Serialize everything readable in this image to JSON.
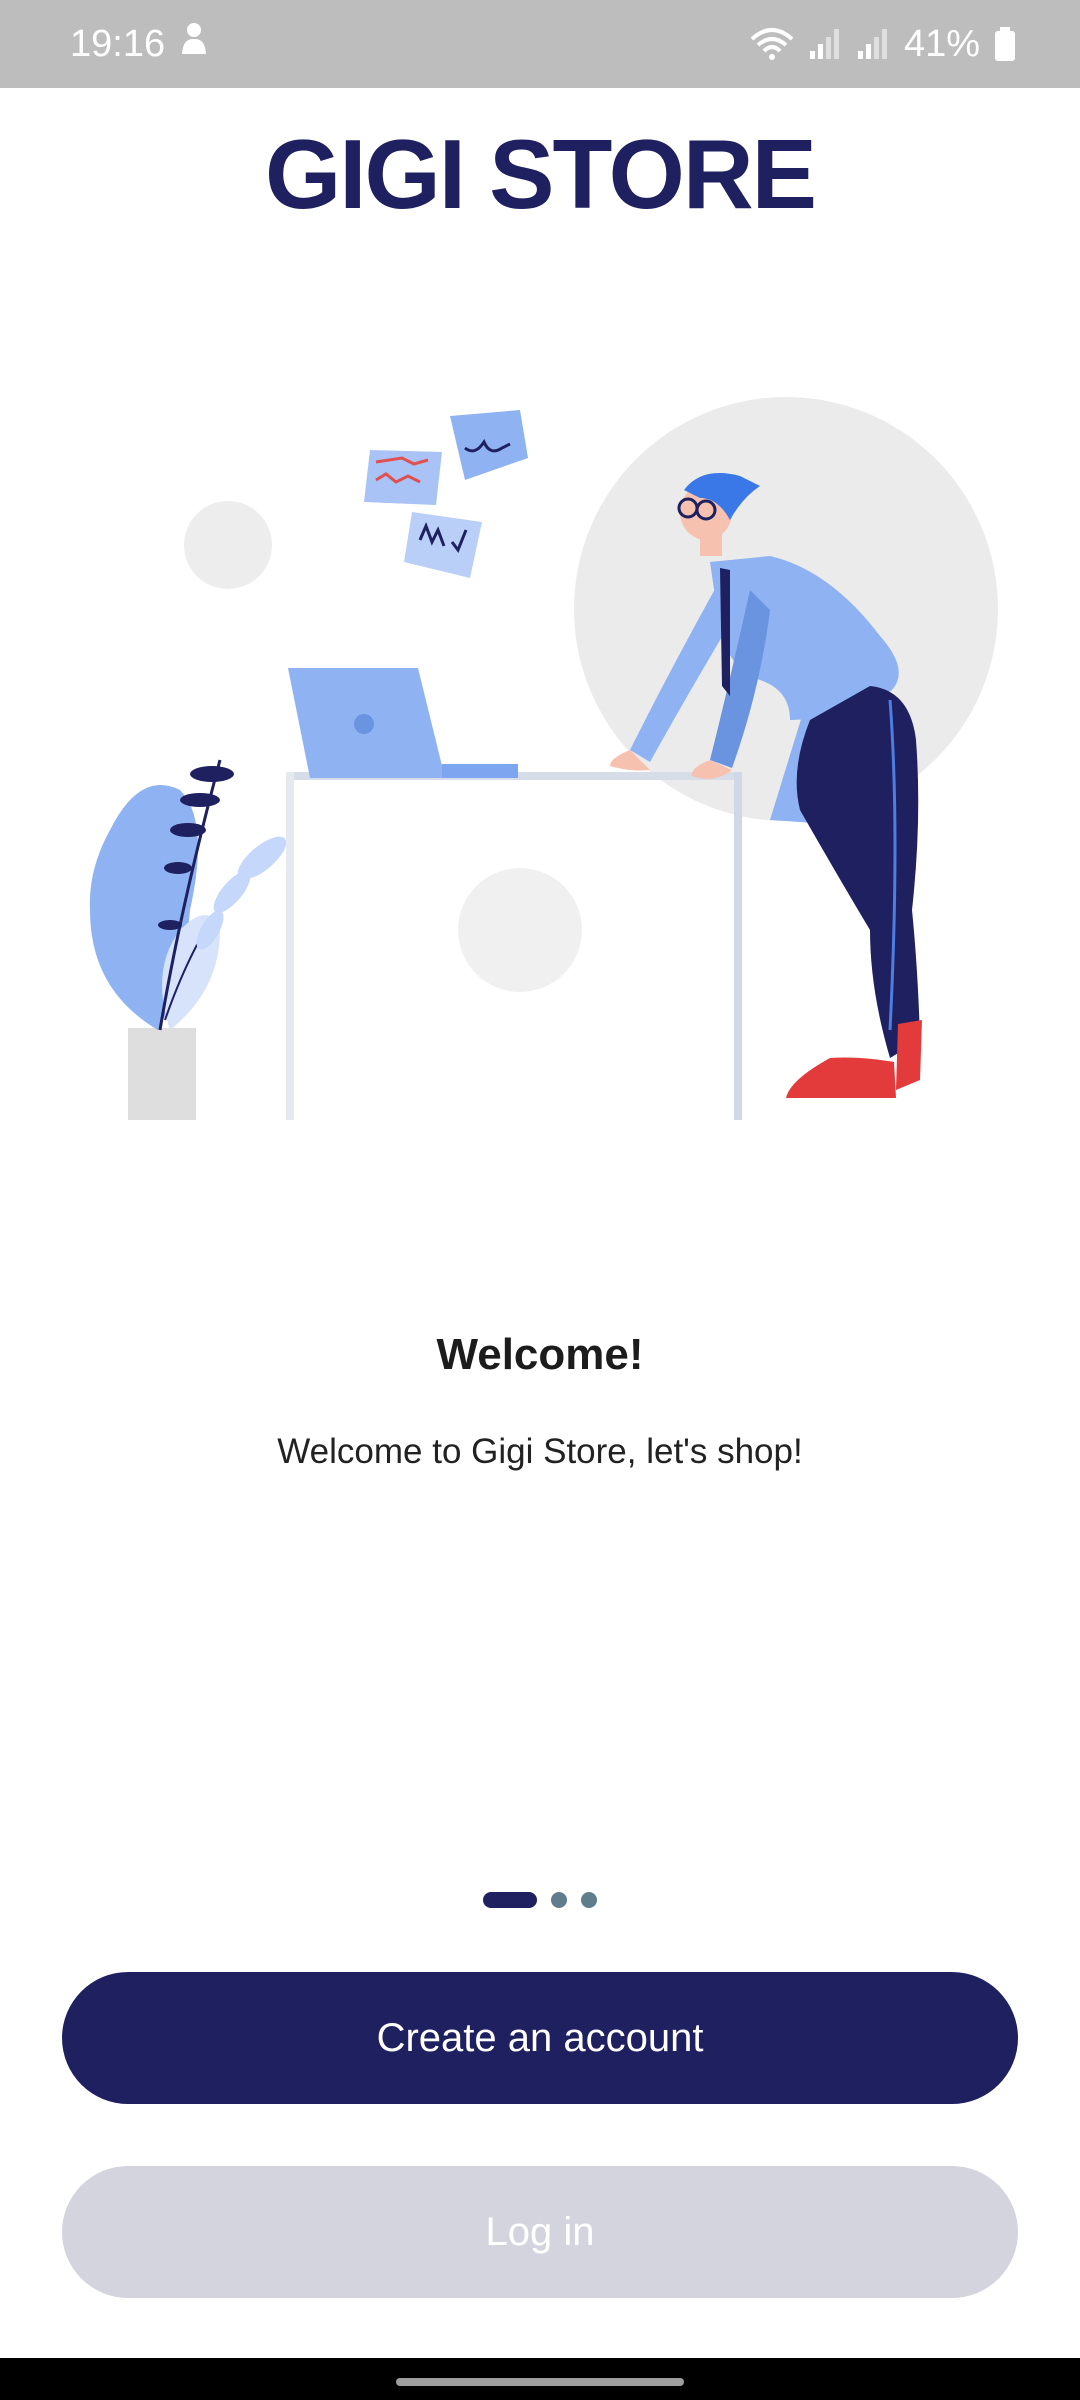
{
  "status_bar": {
    "time": "19:16",
    "battery": "41%",
    "icons": [
      "person-icon",
      "wifi-icon",
      "signal-icon",
      "signal-icon",
      "battery-icon"
    ]
  },
  "brand": {
    "name": "GIGI STORE",
    "color": "#1e2060"
  },
  "illustration": {
    "icon": "person-at-desk-illustration",
    "accent": "#8fb2f2"
  },
  "welcome": {
    "title": "Welcome!",
    "subtitle": "Welcome to Gigi Store, let's shop!"
  },
  "pager": {
    "total": 3,
    "active_index": 0
  },
  "actions": {
    "create_account_label": "Create an account",
    "login_label": "Log in"
  },
  "colors": {
    "primary": "#1e2060",
    "disabled": "#d4d4df",
    "status_bar": "#bdbdbd"
  }
}
